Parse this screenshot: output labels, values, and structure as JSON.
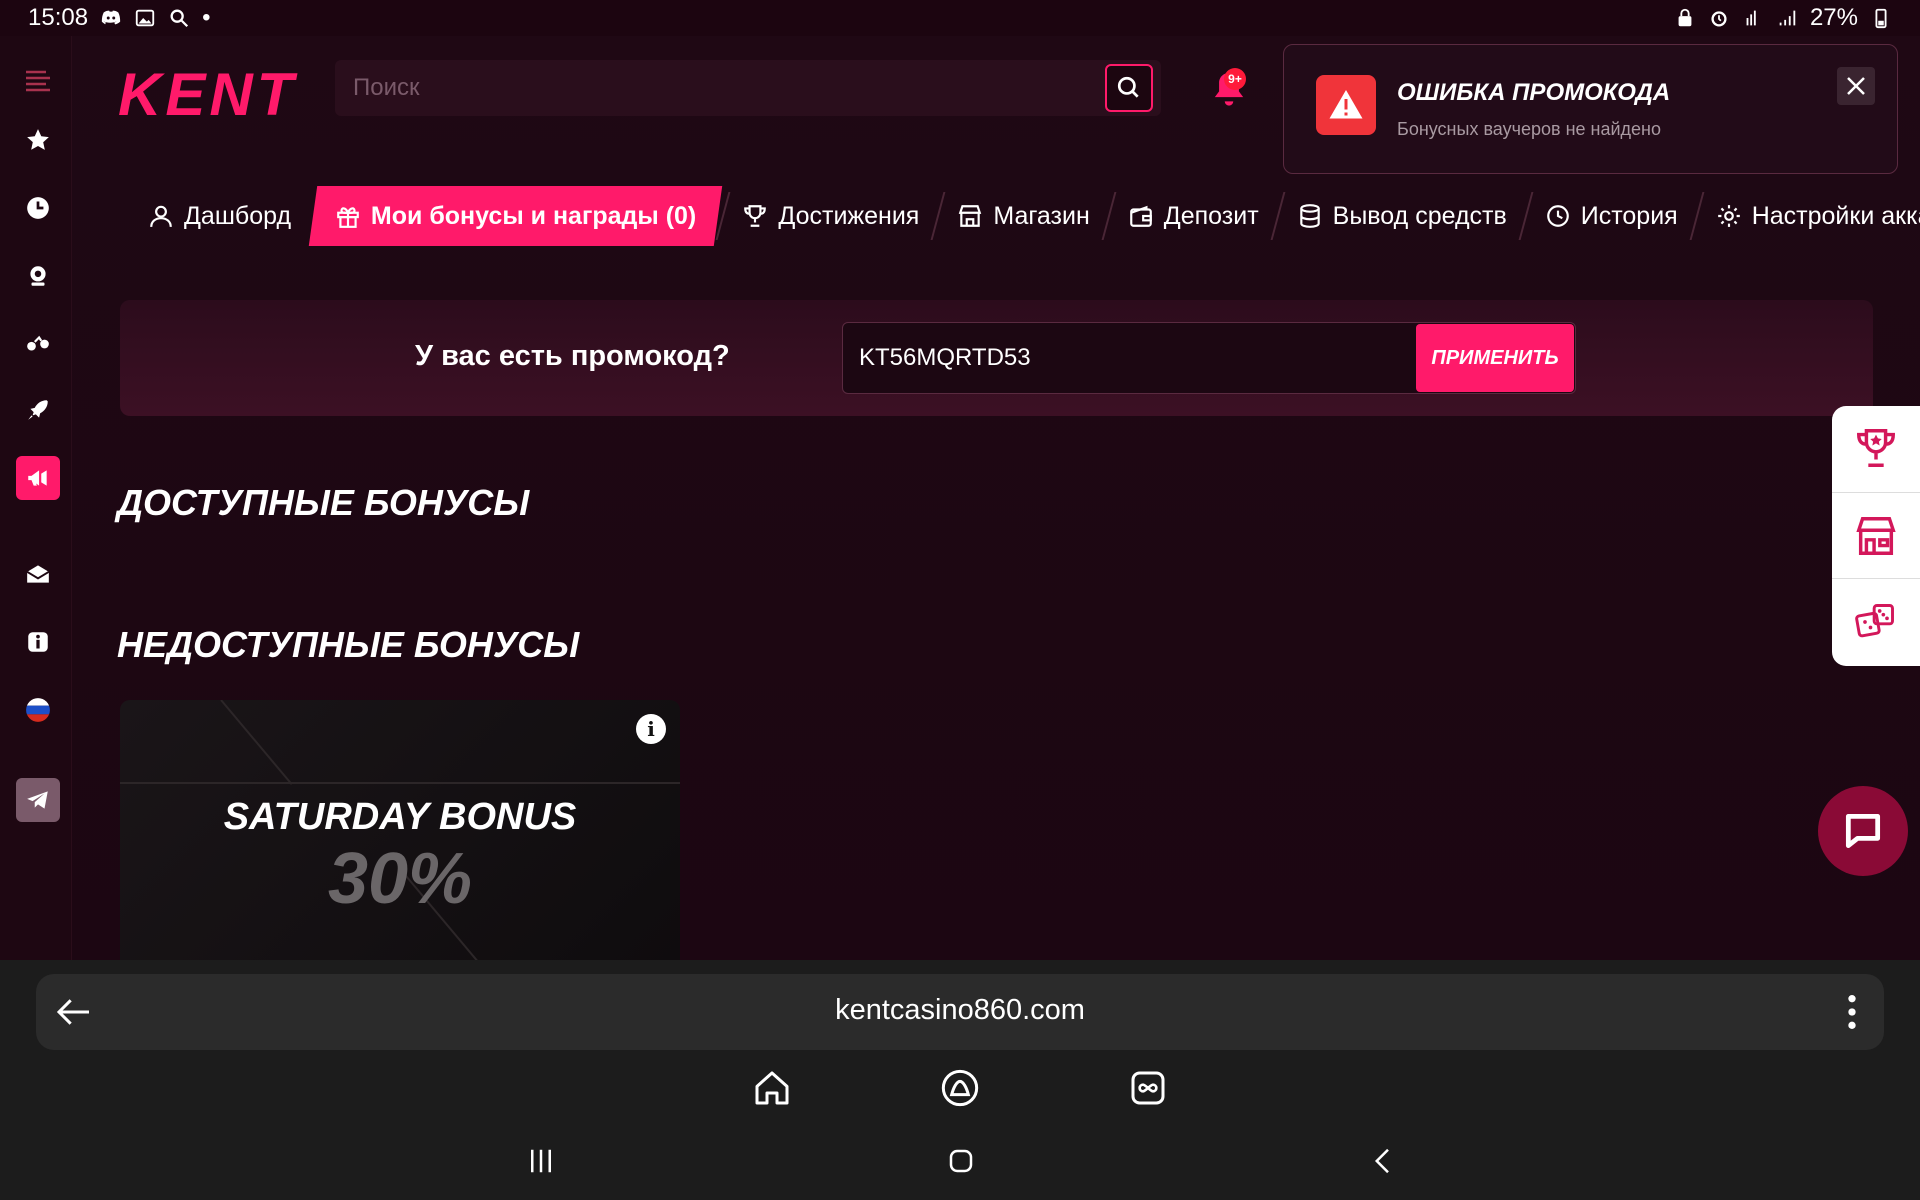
{
  "status_bar": {
    "time": "15:08",
    "dot": "•",
    "battery": "27%"
  },
  "header": {
    "logo": "KENT",
    "search_placeholder": "Поиск",
    "notifications_badge": "9+"
  },
  "toast": {
    "title": "ОШИБКА ПРОМОКОДА",
    "message": "Бонусных ваучеров не найдено"
  },
  "tabs": [
    {
      "label": "Дашборд",
      "icon": "user-icon",
      "active": false
    },
    {
      "label": "Мои бонусы и награды (0)",
      "icon": "gift-icon",
      "active": true
    },
    {
      "label": "Достижения",
      "icon": "trophy-icon",
      "active": false
    },
    {
      "label": "Магазин",
      "icon": "store-icon",
      "active": false
    },
    {
      "label": "Депозит",
      "icon": "wallet-icon",
      "active": false
    },
    {
      "label": "Вывод средств",
      "icon": "coins-icon",
      "active": false
    },
    {
      "label": "История",
      "icon": "history-icon",
      "active": false
    },
    {
      "label": "Настройки аккаун",
      "icon": "gear-icon",
      "active": false
    }
  ],
  "promo": {
    "label": "У вас есть промокод?",
    "value": "KT56MQRTD53",
    "apply_label": "ПРИМЕНИТЬ"
  },
  "sections": {
    "available": "ДОСТУПНЫЕ БОНУСЫ",
    "unavailable": "НЕДОСТУПНЫЕ БОНУСЫ"
  },
  "bonus_card": {
    "title": "SATURDAY BONUS",
    "percent": "30%",
    "info": "i"
  },
  "browser": {
    "url": "kentcasino860.com"
  },
  "colors": {
    "accent": "#ff1a6a",
    "background": "#1f0814",
    "error": "#f0343a"
  }
}
